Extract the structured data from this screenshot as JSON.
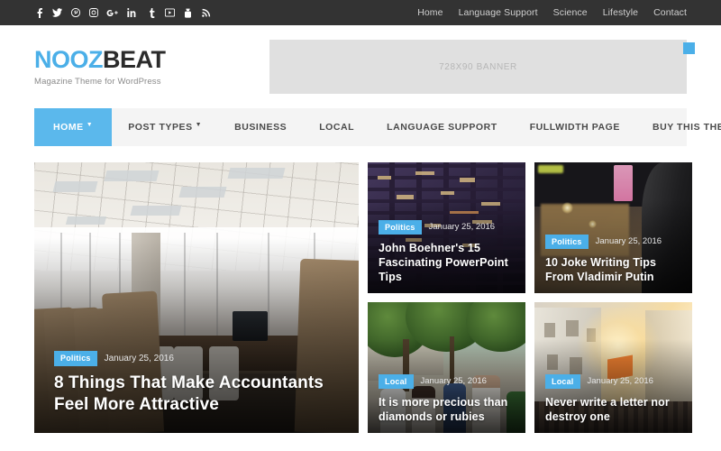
{
  "topbar": {
    "social": [
      {
        "name": "facebook-icon",
        "glyph": "f"
      },
      {
        "name": "twitter-icon",
        "glyph": "t"
      },
      {
        "name": "pinterest-icon",
        "glyph": "P"
      },
      {
        "name": "instagram-icon",
        "glyph": "I"
      },
      {
        "name": "google-plus-icon",
        "glyph": "G+"
      },
      {
        "name": "linkedin-icon",
        "glyph": "in"
      },
      {
        "name": "tumblr-icon",
        "glyph": "t"
      },
      {
        "name": "vimeo-icon",
        "glyph": "V"
      },
      {
        "name": "youtube-icon",
        "glyph": "Y"
      },
      {
        "name": "rss-icon",
        "glyph": "R"
      }
    ],
    "nav": [
      {
        "label": "Home"
      },
      {
        "label": "Language Support"
      },
      {
        "label": "Science"
      },
      {
        "label": "Lifestyle"
      },
      {
        "label": "Contact"
      }
    ]
  },
  "header": {
    "logo_primary": "NOOZ",
    "logo_secondary": "BEAT",
    "tagline": "Magazine Theme for WordPress",
    "banner_text": "728X90 BANNER"
  },
  "mainnav": {
    "items": [
      {
        "label": "HOME",
        "active": true,
        "caret": true
      },
      {
        "label": "POST TYPES",
        "active": false,
        "caret": true
      },
      {
        "label": "BUSINESS",
        "active": false,
        "caret": false
      },
      {
        "label": "LOCAL",
        "active": false,
        "caret": false
      },
      {
        "label": "LANGUAGE SUPPORT",
        "active": false,
        "caret": false
      },
      {
        "label": "FULLWIDTH PAGE",
        "active": false,
        "caret": false
      },
      {
        "label": "BUY THIS THEME",
        "active": false,
        "caret": false
      }
    ],
    "search_icon": "search-icon"
  },
  "posts": {
    "hero": {
      "category": "Politics",
      "date": "January 25, 2016",
      "title": "8 Things That Make Accountants Feel More Attractive",
      "image": "conference-room-photo"
    },
    "cards": [
      {
        "category": "Politics",
        "date": "January 25, 2016",
        "title": "John Boehner's 15 Fascinating PowerPoint Tips",
        "image": "night-building-facade-photo"
      },
      {
        "category": "Politics",
        "date": "January 25, 2016",
        "title": "10 Joke Writing Tips From Vladimir Putin",
        "image": "night-street-man-photo"
      },
      {
        "category": "Local",
        "date": "January 25, 2016",
        "title": "It is more precious than diamonds or rubies",
        "image": "tourists-park-photo"
      },
      {
        "category": "Local",
        "date": "January 25, 2016",
        "title": "Never write a letter nor destroy one",
        "image": "sunlit-city-street-photo"
      }
    ]
  },
  "colors": {
    "accent": "#4BAFE8",
    "nav_active": "#5BB8EC",
    "topbar_bg": "#333333",
    "nav_bg": "#f4f4f4",
    "banner_bg": "#e0e0e0"
  }
}
